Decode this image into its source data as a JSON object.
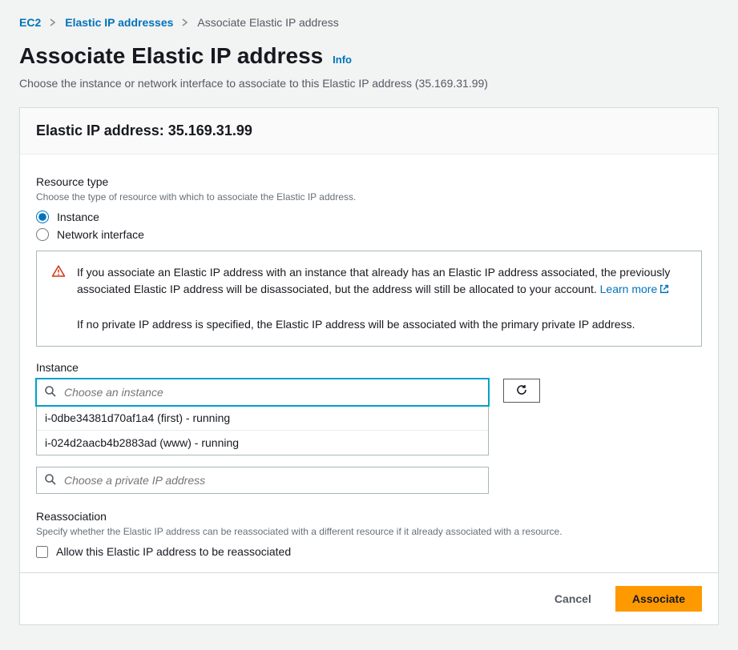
{
  "breadcrumb": {
    "root": "EC2",
    "mid": "Elastic IP addresses",
    "current": "Associate Elastic IP address"
  },
  "header": {
    "title": "Associate Elastic IP address",
    "info": "Info",
    "subtitle": "Choose the instance or network interface to associate to this Elastic IP address (35.169.31.99)"
  },
  "panel": {
    "heading": "Elastic IP address: 35.169.31.99"
  },
  "resource_type": {
    "label": "Resource type",
    "help": "Choose the type of resource with which to associate the Elastic IP address.",
    "opt_instance": "Instance",
    "opt_eni": "Network interface",
    "selected": "instance"
  },
  "warning": {
    "part1": "If you associate an Elastic IP address with an instance that already has an Elastic IP address associated, the previously associated Elastic IP address will be disassociated, but the address will still be allocated to your account. ",
    "learn_more": "Learn more",
    "part2": "If no private IP address is specified, the Elastic IP address will be associated with the primary private IP address."
  },
  "instance": {
    "label": "Instance",
    "placeholder": "Choose an instance",
    "options": [
      "i-0dbe34381d70af1a4 (first) - running",
      "i-024d2aacb4b2883ad (www) - running"
    ]
  },
  "private_ip": {
    "placeholder": "Choose a private IP address"
  },
  "reassoc": {
    "label": "Reassociation",
    "help": "Specify whether the Elastic IP address can be reassociated with a different resource if it already associated with a resource.",
    "check_label": "Allow this Elastic IP address to be reassociated"
  },
  "footer": {
    "cancel": "Cancel",
    "submit": "Associate"
  }
}
